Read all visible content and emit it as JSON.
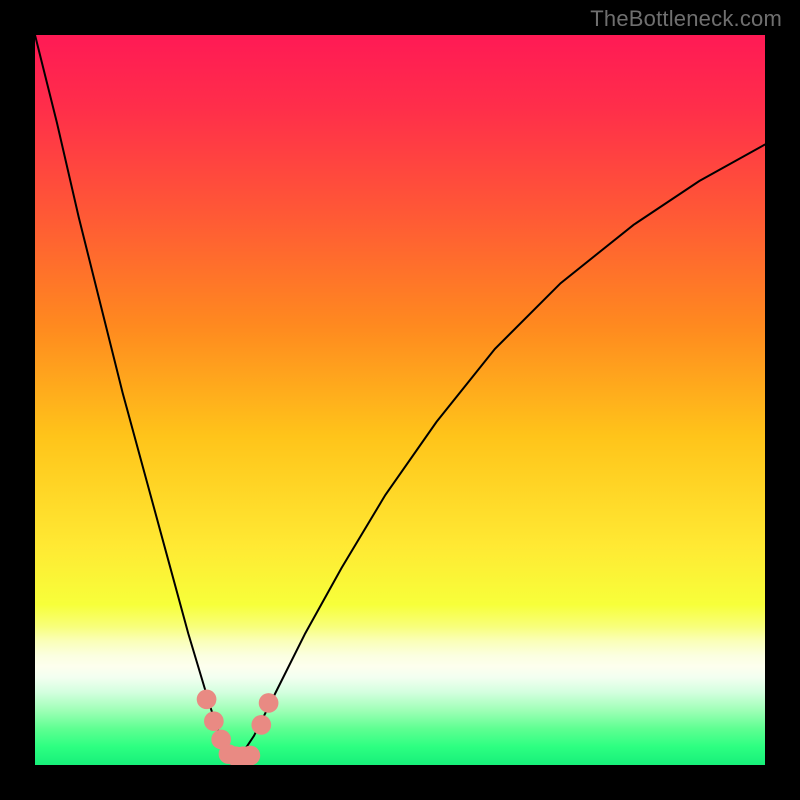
{
  "watermark": "TheBottleneck.com",
  "colors": {
    "frame": "#000000",
    "curve_stroke": "#000000",
    "dot_fill": "#e98a83",
    "gradient_stops": [
      {
        "offset": "0%",
        "color": "#ff1a55"
      },
      {
        "offset": "10%",
        "color": "#ff2e4a"
      },
      {
        "offset": "25%",
        "color": "#ff5a35"
      },
      {
        "offset": "40%",
        "color": "#ff8a1f"
      },
      {
        "offset": "55%",
        "color": "#ffc41a"
      },
      {
        "offset": "70%",
        "color": "#ffe933"
      },
      {
        "offset": "78%",
        "color": "#f7ff3a"
      },
      {
        "offset": "81%",
        "color": "#f8ff7a"
      },
      {
        "offset": "83%",
        "color": "#faffb8"
      },
      {
        "offset": "85%",
        "color": "#fbffe0"
      },
      {
        "offset": "86.5%",
        "color": "#fdffee"
      },
      {
        "offset": "88%",
        "color": "#f2fff0"
      },
      {
        "offset": "90%",
        "color": "#d4ffdf"
      },
      {
        "offset": "92.5%",
        "color": "#9fffb7"
      },
      {
        "offset": "95%",
        "color": "#5fff92"
      },
      {
        "offset": "97.5%",
        "color": "#2dff81"
      },
      {
        "offset": "100%",
        "color": "#17f07a"
      }
    ]
  },
  "chart_data": {
    "type": "line",
    "title": "",
    "xlabel": "",
    "ylabel": "",
    "xlim": [
      0,
      100
    ],
    "ylim": [
      0,
      100
    ],
    "note": "Bottleneck-style V curve. X is hardware balance position (0–100). Y is percentage bottleneck (0 = none, 100 = severe). Background hue encodes Y value: red=high, yellow=mid, green=0. Curve minimum sits at roughly x≈27, y≈0.",
    "series": [
      {
        "name": "bottleneck-curve",
        "x": [
          0,
          3,
          6,
          9,
          12,
          15,
          18,
          21,
          24,
          26,
          27,
          28,
          30,
          33,
          37,
          42,
          48,
          55,
          63,
          72,
          82,
          91,
          100
        ],
        "values": [
          100,
          88,
          75,
          63,
          51,
          40,
          29,
          18,
          8,
          2,
          0,
          1,
          4,
          10,
          18,
          27,
          37,
          47,
          57,
          66,
          74,
          80,
          85
        ]
      }
    ],
    "markers": [
      {
        "name": "dot-1",
        "x": 23.5,
        "y": 9
      },
      {
        "name": "dot-2",
        "x": 24.5,
        "y": 6
      },
      {
        "name": "dot-3",
        "x": 25.5,
        "y": 3.5
      },
      {
        "name": "dot-4",
        "x": 26.5,
        "y": 1.5
      },
      {
        "name": "dot-5",
        "x": 27.5,
        "y": 1.2
      },
      {
        "name": "dot-6",
        "x": 28.5,
        "y": 1.2
      },
      {
        "name": "dot-7",
        "x": 29.5,
        "y": 1.3
      },
      {
        "name": "dot-8",
        "x": 31.0,
        "y": 5.5
      },
      {
        "name": "dot-9",
        "x": 32.0,
        "y": 8.5
      }
    ]
  }
}
